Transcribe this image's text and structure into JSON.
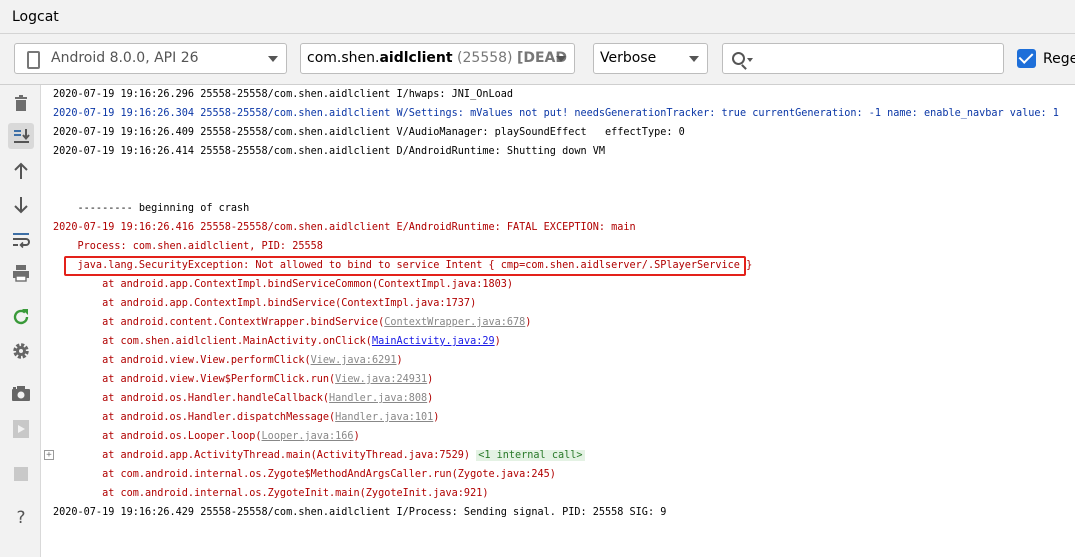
{
  "window": {
    "title": "Logcat"
  },
  "toolbar": {
    "device": "Android 8.0.0, API 26",
    "process_prefix": "com.shen.",
    "process_bold": "aidlclient",
    "process_pid": "(25558)",
    "process_status": "[DEAD",
    "level": "Verbose",
    "search_value": "",
    "regex_label": "Rege",
    "regex_checked": true
  },
  "sidebar": {
    "icons": [
      "trash-icon",
      "scroll-to-end-icon",
      "up-arrow-icon",
      "down-arrow-icon",
      "soft-wrap-icon",
      "print-icon",
      "restart-icon",
      "settings-icon",
      "screenshot-icon",
      "screen-record-icon",
      "stop-icon",
      "help-icon"
    ]
  },
  "log": {
    "lines": [
      {
        "text": "2020-07-19 19:16:26.296 25558-25558/com.shen.aidlclient I/hwaps: JNI_OnLoad"
      },
      {
        "text": "2020-07-19 19:16:26.304 25558-25558/com.shen.aidlclient W/Settings: mValues not put! needsGenerationTracker: true currentGeneration: -1 name: enable_navbar value: 1"
      },
      {
        "text": "2020-07-19 19:16:26.409 25558-25558/com.shen.aidlclient V/AudioManager: playSoundEffect   effectType: 0"
      },
      {
        "text": "2020-07-19 19:16:26.414 25558-25558/com.shen.aidlclient D/AndroidRuntime: Shutting down VM"
      },
      {
        "text": "    --------- beginning of crash"
      },
      {
        "text": "2020-07-19 19:16:26.416 25558-25558/com.shen.aidlclient E/AndroidRuntime: FATAL EXCEPTION: main"
      },
      {
        "text": "    Process: com.shen.aidlclient, PID: 25558"
      },
      {
        "text": "    java.lang.SecurityException: Not allowed to bind to service Intent { cmp=com.shen.aidlserver/.SPlayerService }"
      },
      {
        "text": "        at android.app.ContextImpl.bindServiceCommon(ContextImpl.java:1803)"
      },
      {
        "text": "        at android.app.ContextImpl.bindService(ContextImpl.java:1737)"
      },
      {
        "pre": "        at android.content.ContextWrapper.bindService(",
        "link": "ContextWrapper.java:678",
        "post": ")"
      },
      {
        "pre": "        at com.shen.aidlclient.MainActivity.onClick(",
        "link": "MainActivity.java:29",
        "post": ")"
      },
      {
        "pre": "        at android.view.View.performClick(",
        "link": "View.java:6291",
        "post": ")"
      },
      {
        "pre": "        at android.view.View$PerformClick.run(",
        "link": "View.java:24931",
        "post": ")"
      },
      {
        "pre": "        at android.os.Handler.handleCallback(",
        "link": "Handler.java:808",
        "post": ")"
      },
      {
        "pre": "        at android.os.Handler.dispatchMessage(",
        "link": "Handler.java:101",
        "post": ")"
      },
      {
        "pre": "        at android.os.Looper.loop(",
        "link": "Looper.java:166",
        "post": ")"
      },
      {
        "pre": "        at android.app.ActivityThread.main(ActivityThread.java:7529) ",
        "badge": "<1 internal call>"
      },
      {
        "text": "        at com.android.internal.os.Zygote$MethodAndArgsCaller.run(Zygote.java:245)"
      },
      {
        "text": "        at com.android.internal.os.ZygoteInit.main(ZygoteInit.java:921)"
      },
      {
        "text": "2020-07-19 19:16:26.429 25558-25558/com.shen.aidlclient I/Process: Sending signal. PID: 25558 SIG: 9"
      }
    ]
  }
}
